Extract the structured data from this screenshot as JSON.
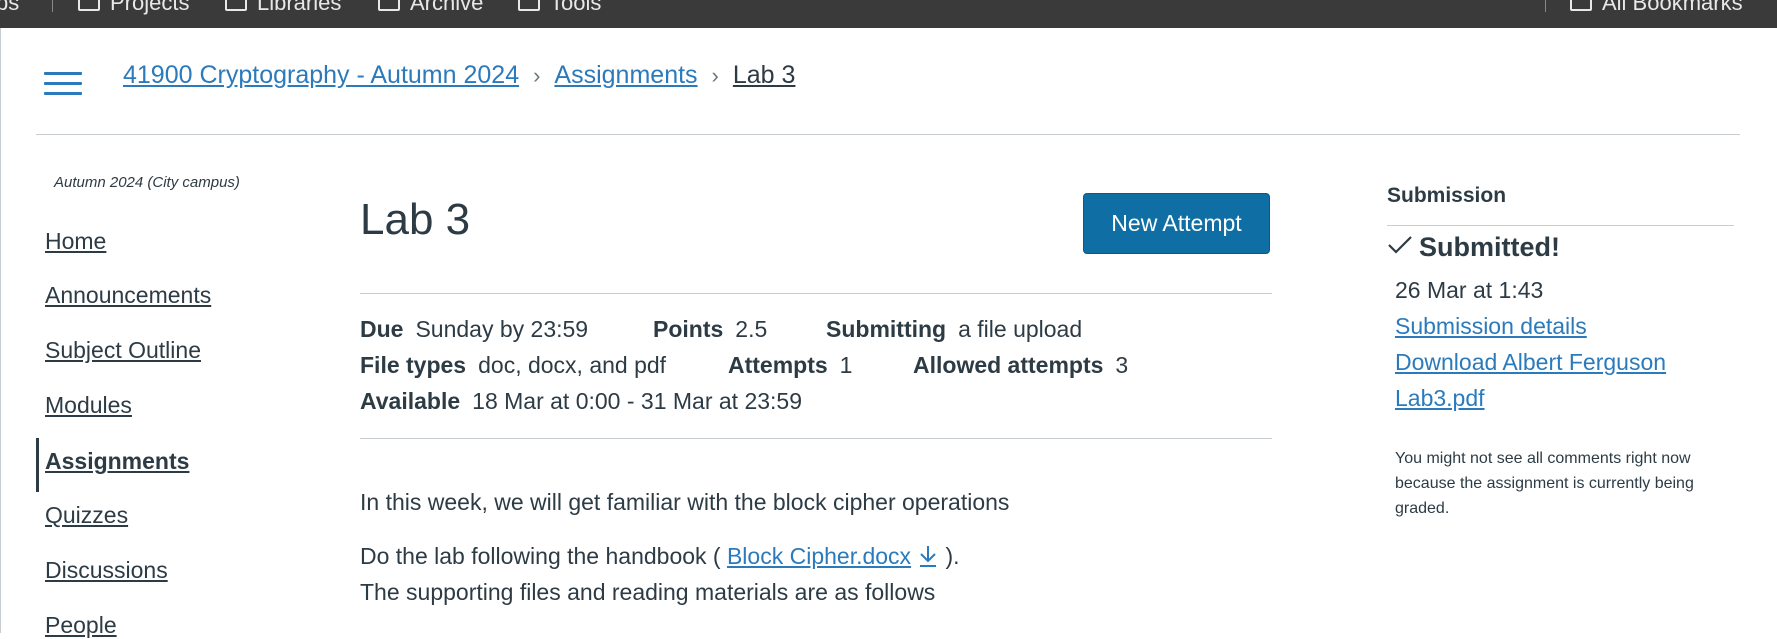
{
  "bookmarks": {
    "items": [
      "Projects",
      "Libraries",
      "Archive",
      "Tools"
    ],
    "all_bookmarks": "All Bookmarks",
    "left_fragment": "ps"
  },
  "header": {
    "breadcrumbs": [
      "41900 Cryptography - Autumn 2024",
      "Assignments",
      "Lab 3"
    ]
  },
  "course_nav": {
    "term": "Autumn 2024 (City campus)",
    "items": [
      "Home",
      "Announcements",
      "Subject Outline",
      "Modules",
      "Assignments",
      "Quizzes",
      "Discussions",
      "People"
    ],
    "active": "Assignments"
  },
  "assignment": {
    "title": "Lab 3",
    "new_attempt_label": "New Attempt",
    "due_label": "Due",
    "due_value": "Sunday by 23:59",
    "points_label": "Points",
    "points_value": "2.5",
    "submitting_label": "Submitting",
    "submitting_value": "a file upload",
    "file_types_label": "File types",
    "file_types_value": "doc, docx, and pdf",
    "attempts_label": "Attempts",
    "attempts_value": "1",
    "allowed_attempts_label": "Allowed attempts",
    "allowed_attempts_value": "3",
    "available_label": "Available",
    "available_value": "18 Mar at 0:00 - 31 Mar at 23:59",
    "description_line1": "In this week, we will get familiar with the block cipher operations",
    "description_line2_prefix": "Do the lab following the handbook ( ",
    "handbook_link": "Block Cipher.docx",
    "description_line2_suffix": " ).",
    "description_line3": "The supporting files and reading materials are as follows"
  },
  "submission": {
    "heading": "Submission",
    "status": "Submitted!",
    "date": "26 Mar at 1:43",
    "details_link": "Submission details",
    "download_line1": "Download Albert Ferguson",
    "download_line2": "Lab3.pdf",
    "note": "You might not see all comments right now because the assignment is currently being graded."
  },
  "colors": {
    "link": "#2b7abc",
    "text": "#2d3b45",
    "button": "#0f6fa5",
    "bookmark_bar": "#3a3a3a"
  }
}
